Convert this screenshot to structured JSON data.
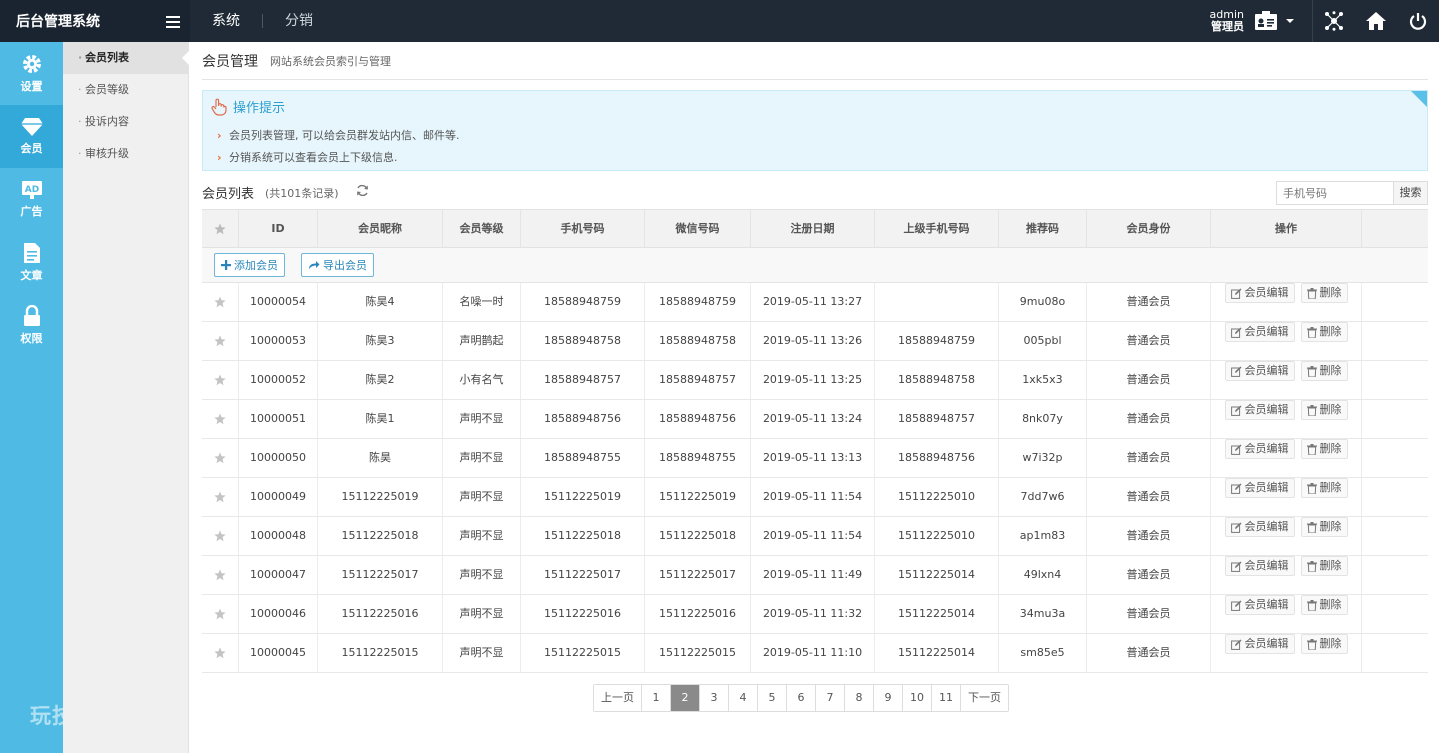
{
  "brand": {
    "title": "后台管理系统"
  },
  "top_nav": [
    {
      "label": "系统",
      "active": true
    },
    {
      "label": "分销",
      "active": false
    }
  ],
  "user": {
    "name": "admin",
    "role": "管理员"
  },
  "sidebar": [
    {
      "label": "设置",
      "icon": "gear-icon",
      "active": false
    },
    {
      "label": "会员",
      "icon": "diamond-icon",
      "active": true
    },
    {
      "label": "广告",
      "icon": "ad-icon",
      "active": false
    },
    {
      "label": "文章",
      "icon": "document-icon",
      "active": false
    },
    {
      "label": "权限",
      "icon": "lock-icon",
      "active": false
    }
  ],
  "sidebar_logo": "玩技e族",
  "submenu": [
    {
      "label": "会员列表",
      "active": true
    },
    {
      "label": "会员等级",
      "active": false
    },
    {
      "label": "投诉内容",
      "active": false
    },
    {
      "label": "审核升级",
      "active": false
    }
  ],
  "page": {
    "title": "会员管理",
    "subtitle": "网站系统会员索引与管理"
  },
  "tips": {
    "title": "操作提示",
    "items": [
      "会员列表管理, 可以给会员群发站内信、邮件等.",
      "分销系统可以查看会员上下级信息."
    ]
  },
  "list": {
    "title": "会员列表",
    "count": "(共101条记录)",
    "search_placeholder": "手机号码",
    "search_label": "搜索",
    "add_label": "添加会员",
    "export_label": "导出会员"
  },
  "table": {
    "headers": [
      "",
      "ID",
      "会员昵称",
      "会员等级",
      "手机号码",
      "微信号码",
      "注册日期",
      "上级手机号码",
      "推荐码",
      "会员身份",
      "操作",
      ""
    ],
    "edit_label": "会员编辑",
    "delete_label": "删除",
    "rows": [
      [
        "10000054",
        "陈昊4",
        "名噪一时",
        "18588948759",
        "18588948759",
        "2019-05-11 13:27",
        "",
        "9mu08o",
        "普通会员"
      ],
      [
        "10000053",
        "陈昊3",
        "声明鹊起",
        "18588948758",
        "18588948758",
        "2019-05-11 13:26",
        "18588948759",
        "005pbl",
        "普通会员"
      ],
      [
        "10000052",
        "陈昊2",
        "小有名气",
        "18588948757",
        "18588948757",
        "2019-05-11 13:25",
        "18588948758",
        "1xk5x3",
        "普通会员"
      ],
      [
        "10000051",
        "陈昊1",
        "声明不显",
        "18588948756",
        "18588948756",
        "2019-05-11 13:24",
        "18588948757",
        "8nk07y",
        "普通会员"
      ],
      [
        "10000050",
        "陈昊",
        "声明不显",
        "18588948755",
        "18588948755",
        "2019-05-11 13:13",
        "18588948756",
        "w7i32p",
        "普通会员"
      ],
      [
        "10000049",
        "15112225019",
        "声明不显",
        "15112225019",
        "15112225019",
        "2019-05-11 11:54",
        "15112225010",
        "7dd7w6",
        "普通会员"
      ],
      [
        "10000048",
        "15112225018",
        "声明不显",
        "15112225018",
        "15112225018",
        "2019-05-11 11:54",
        "15112225010",
        "ap1m83",
        "普通会员"
      ],
      [
        "10000047",
        "15112225017",
        "声明不显",
        "15112225017",
        "15112225017",
        "2019-05-11 11:49",
        "15112225014",
        "49lxn4",
        "普通会员"
      ],
      [
        "10000046",
        "15112225016",
        "声明不显",
        "15112225016",
        "15112225016",
        "2019-05-11 11:32",
        "15112225014",
        "34mu3a",
        "普通会员"
      ],
      [
        "10000045",
        "15112225015",
        "声明不显",
        "15112225015",
        "15112225015",
        "2019-05-11 11:10",
        "15112225014",
        "sm85e5",
        "普通会员"
      ]
    ]
  },
  "pagination": {
    "prev": "上一页",
    "next": "下一页",
    "pages": [
      "1",
      "2",
      "3",
      "4",
      "5",
      "6",
      "7",
      "8",
      "9",
      "10",
      "11"
    ],
    "current": "2"
  },
  "colors": {
    "sidebar": "#4fbbe4",
    "topbar": "#1f2a36",
    "accent": "#2c9fce"
  }
}
